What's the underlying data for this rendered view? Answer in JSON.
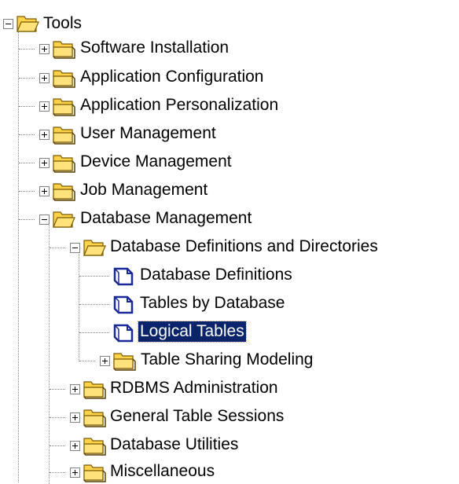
{
  "colors": {
    "selection_bg": "#0a246a",
    "selection_text": "#ffffff",
    "folder_yellow": "#ffd24a",
    "folder_dark": "#c89b00",
    "leaf_blue": "#1a2a9a"
  },
  "tree": {
    "root": {
      "label": "Tools",
      "icon": "folder-open-icon",
      "expanded": true
    },
    "items": [
      {
        "label": "Software Installation",
        "icon": "folder-icon",
        "expanded": false
      },
      {
        "label": "Application Configuration",
        "icon": "folder-icon",
        "expanded": false
      },
      {
        "label": "Application Personalization",
        "icon": "folder-icon",
        "expanded": false
      },
      {
        "label": "User Management",
        "icon": "folder-icon",
        "expanded": false
      },
      {
        "label": "Device Management",
        "icon": "folder-icon",
        "expanded": false
      },
      {
        "label": "Job Management",
        "icon": "folder-icon",
        "expanded": false
      },
      {
        "label": "Database Management",
        "icon": "folder-open-icon",
        "expanded": true
      },
      {
        "label": "Database Definitions and Directories",
        "icon": "folder-open-icon",
        "expanded": true
      },
      {
        "label": "Database Definitions",
        "icon": "document-icon"
      },
      {
        "label": "Tables by Database",
        "icon": "document-icon"
      },
      {
        "label": "Logical Tables",
        "icon": "document-icon",
        "selected": true
      },
      {
        "label": "Table Sharing Modeling",
        "icon": "folder-icon",
        "expanded": false
      },
      {
        "label": "RDBMS Administration",
        "icon": "folder-icon",
        "expanded": false
      },
      {
        "label": "General Table Sessions",
        "icon": "folder-icon",
        "expanded": false
      },
      {
        "label": "Database Utilities",
        "icon": "folder-icon",
        "expanded": false
      },
      {
        "label": "Miscellaneous",
        "icon": "folder-icon",
        "expanded": false
      }
    ]
  }
}
